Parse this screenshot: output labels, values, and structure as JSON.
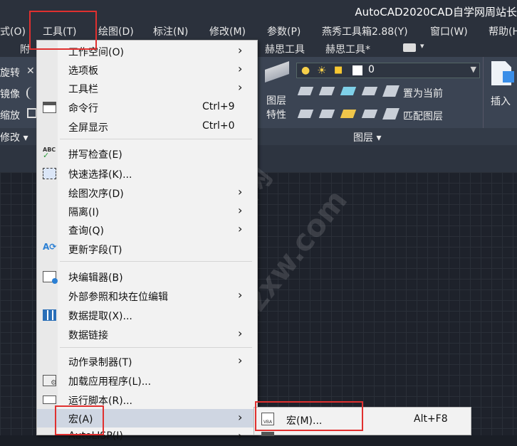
{
  "app": {
    "title": "AutoCAD2020CAD自学网周站长"
  },
  "menubar": {
    "items": [
      "式(O)",
      "工具(T)",
      "绘图(D)",
      "标注(N)",
      "修改(M)",
      "参数(P)",
      "燕秀工具箱2.88(Y)",
      "窗口(W)",
      "帮助(H"
    ]
  },
  "tabs": {
    "items": [
      "附",
      "赫思工具",
      "赫思工具*"
    ]
  },
  "ribbon": {
    "left_tools": [
      "旋转",
      "镜像",
      "缩放",
      "修改 ▾"
    ],
    "layer_value": "0",
    "layer_props": "图层\n特性",
    "set_current": "置为当前",
    "match_layer": "匹配图层",
    "panel_title": "图层 ▾",
    "insert": "插入"
  },
  "tools_menu": {
    "items": [
      {
        "label": "工作空间(O)",
        "shortcut": "",
        "arrow": true,
        "icon": ""
      },
      {
        "label": "选项板",
        "shortcut": "",
        "arrow": true,
        "icon": ""
      },
      {
        "label": "工具栏",
        "shortcut": "",
        "arrow": true,
        "icon": ""
      },
      {
        "label": "命令行",
        "shortcut": "Ctrl+9",
        "arrow": false,
        "icon": "command-line-icon"
      },
      {
        "label": "全屏显示",
        "shortcut": "Ctrl+0",
        "arrow": false,
        "icon": ""
      },
      {
        "label": "拼写检查(E)",
        "shortcut": "",
        "arrow": false,
        "icon": "spell-check-icon"
      },
      {
        "label": "快速选择(K)...",
        "shortcut": "",
        "arrow": false,
        "icon": "quick-select-icon"
      },
      {
        "label": "绘图次序(D)",
        "shortcut": "",
        "arrow": true,
        "icon": ""
      },
      {
        "label": "隔离(I)",
        "shortcut": "",
        "arrow": true,
        "icon": ""
      },
      {
        "label": "查询(Q)",
        "shortcut": "",
        "arrow": true,
        "icon": ""
      },
      {
        "label": "更新字段(T)",
        "shortcut": "",
        "arrow": false,
        "icon": "update-field-icon"
      },
      {
        "label": "块编辑器(B)",
        "shortcut": "",
        "arrow": false,
        "icon": "block-editor-icon"
      },
      {
        "label": "外部参照和块在位编辑",
        "shortcut": "",
        "arrow": true,
        "icon": ""
      },
      {
        "label": "数据提取(X)...",
        "shortcut": "",
        "arrow": false,
        "icon": "data-extraction-icon"
      },
      {
        "label": "数据链接",
        "shortcut": "",
        "arrow": true,
        "icon": ""
      },
      {
        "label": "动作录制器(T)",
        "shortcut": "",
        "arrow": true,
        "icon": ""
      },
      {
        "label": "加载应用程序(L)...",
        "shortcut": "",
        "arrow": false,
        "icon": "load-application-icon"
      },
      {
        "label": "运行脚本(R)...",
        "shortcut": "",
        "arrow": false,
        "icon": "run-script-icon"
      },
      {
        "label": "宏(A)",
        "shortcut": "",
        "arrow": true,
        "icon": ""
      },
      {
        "label": "AutoLISP(I)",
        "shortcut": "",
        "arrow": true,
        "icon": ""
      }
    ]
  },
  "macro_submenu": {
    "item_label": "宏(M)...",
    "shortcut": "Alt+F8",
    "icon": "vba-icon"
  },
  "watermark": {
    "text1": "CAD自学网",
    "text2": "cadzxw.com"
  }
}
